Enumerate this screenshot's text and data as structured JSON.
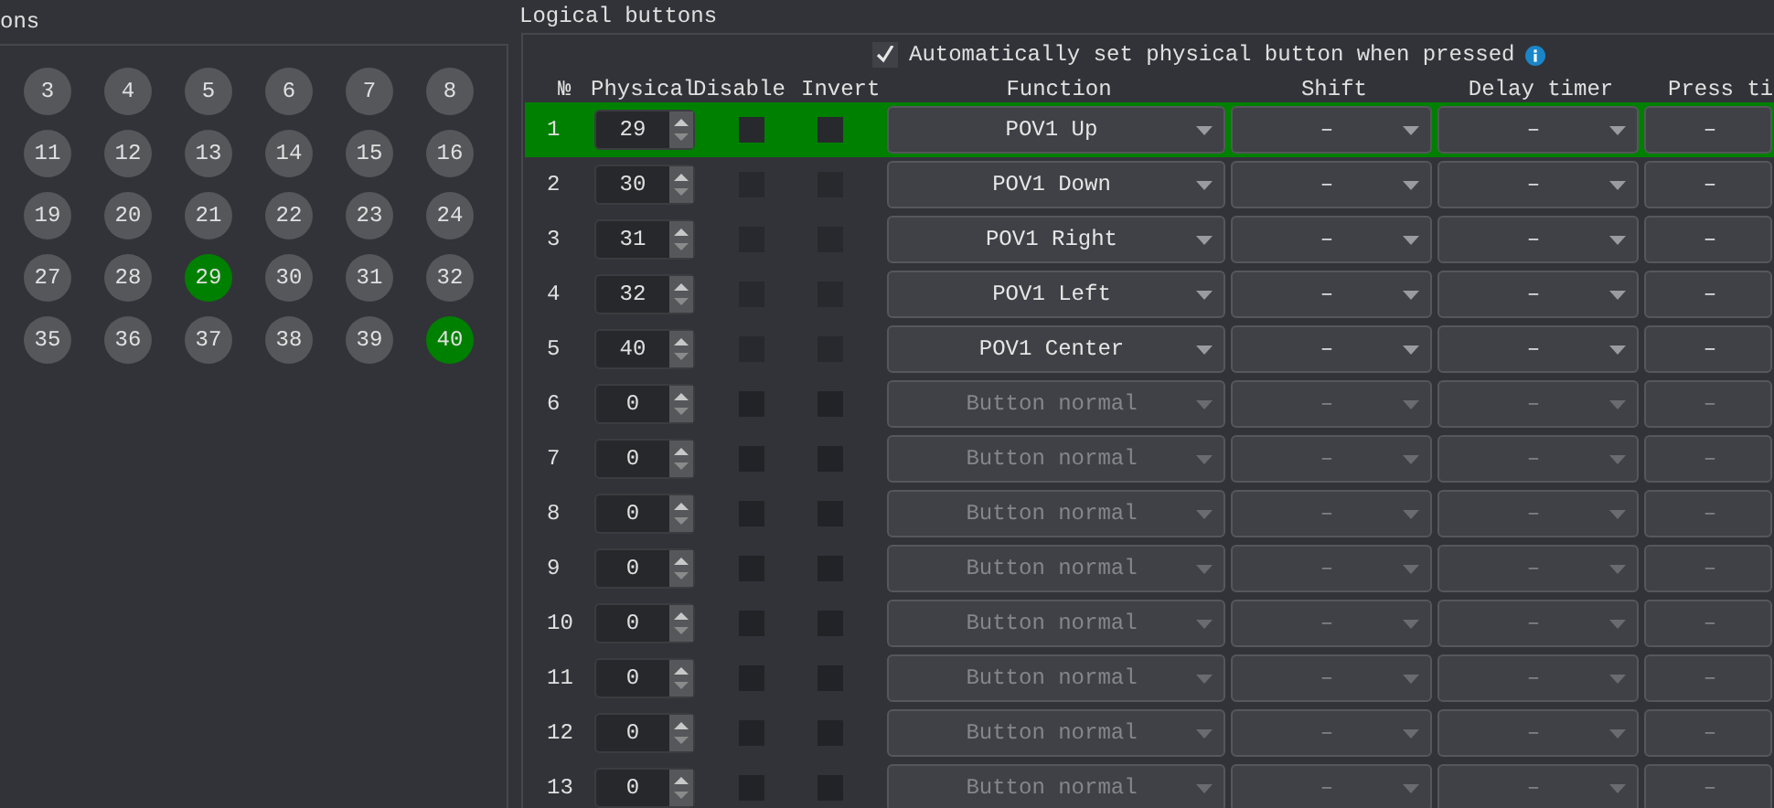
{
  "physical_panel": {
    "title": "ons",
    "buttons": [
      {
        "label": "3",
        "selected": false
      },
      {
        "label": "4",
        "selected": false
      },
      {
        "label": "5",
        "selected": false
      },
      {
        "label": "6",
        "selected": false
      },
      {
        "label": "7",
        "selected": false
      },
      {
        "label": "8",
        "selected": false
      },
      {
        "label": "11",
        "selected": false
      },
      {
        "label": "12",
        "selected": false
      },
      {
        "label": "13",
        "selected": false
      },
      {
        "label": "14",
        "selected": false
      },
      {
        "label": "15",
        "selected": false
      },
      {
        "label": "16",
        "selected": false
      },
      {
        "label": "19",
        "selected": false
      },
      {
        "label": "20",
        "selected": false
      },
      {
        "label": "21",
        "selected": false
      },
      {
        "label": "22",
        "selected": false
      },
      {
        "label": "23",
        "selected": false
      },
      {
        "label": "24",
        "selected": false
      },
      {
        "label": "27",
        "selected": false
      },
      {
        "label": "28",
        "selected": false
      },
      {
        "label": "29",
        "selected": true
      },
      {
        "label": "30",
        "selected": false
      },
      {
        "label": "31",
        "selected": false
      },
      {
        "label": "32",
        "selected": false
      },
      {
        "label": "35",
        "selected": false
      },
      {
        "label": "36",
        "selected": false
      },
      {
        "label": "37",
        "selected": false
      },
      {
        "label": "38",
        "selected": false
      },
      {
        "label": "39",
        "selected": false
      },
      {
        "label": "40",
        "selected": true
      }
    ]
  },
  "logical_panel": {
    "title": "Logical buttons",
    "auto_set": {
      "label": "Automatically set physical button when pressed",
      "checked": true
    },
    "columns": [
      "№",
      "Physical",
      "Disable",
      "Invert",
      "Function",
      "Shift",
      "Delay timer",
      "Press ti"
    ],
    "rows": [
      {
        "number": "1",
        "physical": "29",
        "disable": false,
        "invert": false,
        "function": "POV1 Up",
        "shift": "–",
        "delay": "–",
        "press": "–",
        "active": true,
        "selected": true
      },
      {
        "number": "2",
        "physical": "30",
        "disable": false,
        "invert": false,
        "function": "POV1 Down",
        "shift": "–",
        "delay": "–",
        "press": "–",
        "active": true,
        "selected": false
      },
      {
        "number": "3",
        "physical": "31",
        "disable": false,
        "invert": false,
        "function": "POV1 Right",
        "shift": "–",
        "delay": "–",
        "press": "–",
        "active": true,
        "selected": false
      },
      {
        "number": "4",
        "physical": "32",
        "disable": false,
        "invert": false,
        "function": "POV1 Left",
        "shift": "–",
        "delay": "–",
        "press": "–",
        "active": true,
        "selected": false
      },
      {
        "number": "5",
        "physical": "40",
        "disable": false,
        "invert": false,
        "function": "POV1 Center",
        "shift": "–",
        "delay": "–",
        "press": "–",
        "active": true,
        "selected": false
      },
      {
        "number": "6",
        "physical": "0",
        "disable": false,
        "invert": false,
        "function": "Button normal",
        "shift": "–",
        "delay": "–",
        "press": "–",
        "active": false,
        "selected": false
      },
      {
        "number": "7",
        "physical": "0",
        "disable": false,
        "invert": false,
        "function": "Button normal",
        "shift": "–",
        "delay": "–",
        "press": "–",
        "active": false,
        "selected": false
      },
      {
        "number": "8",
        "physical": "0",
        "disable": false,
        "invert": false,
        "function": "Button normal",
        "shift": "–",
        "delay": "–",
        "press": "–",
        "active": false,
        "selected": false
      },
      {
        "number": "9",
        "physical": "0",
        "disable": false,
        "invert": false,
        "function": "Button normal",
        "shift": "–",
        "delay": "–",
        "press": "–",
        "active": false,
        "selected": false
      },
      {
        "number": "10",
        "physical": "0",
        "disable": false,
        "invert": false,
        "function": "Button normal",
        "shift": "–",
        "delay": "–",
        "press": "–",
        "active": false,
        "selected": false
      },
      {
        "number": "11",
        "physical": "0",
        "disable": false,
        "invert": false,
        "function": "Button normal",
        "shift": "–",
        "delay": "–",
        "press": "–",
        "active": false,
        "selected": false
      },
      {
        "number": "12",
        "physical": "0",
        "disable": false,
        "invert": false,
        "function": "Button normal",
        "shift": "–",
        "delay": "–",
        "press": "–",
        "active": false,
        "selected": false
      },
      {
        "number": "13",
        "physical": "0",
        "disable": false,
        "invert": false,
        "function": "Button normal",
        "shift": "–",
        "delay": "–",
        "press": "–",
        "active": false,
        "selected": false
      }
    ]
  }
}
